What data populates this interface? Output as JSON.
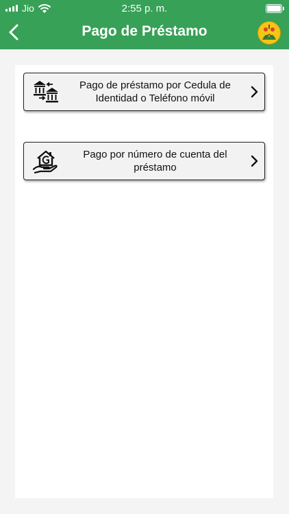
{
  "status_bar": {
    "carrier": "Jio",
    "time": "2:55 p. m."
  },
  "nav": {
    "title": "Pago de Préstamo"
  },
  "options": [
    {
      "label": "Pago de préstamo por Cedula de Identidad o Teléfono móvil",
      "icon": "bank-transfer-icon"
    },
    {
      "label": "Pago por número de cuenta del préstamo",
      "icon": "hand-house-icon"
    }
  ],
  "colors": {
    "header": "#36a157",
    "background": "#f4f4f4",
    "card": "#f2f2f2"
  }
}
